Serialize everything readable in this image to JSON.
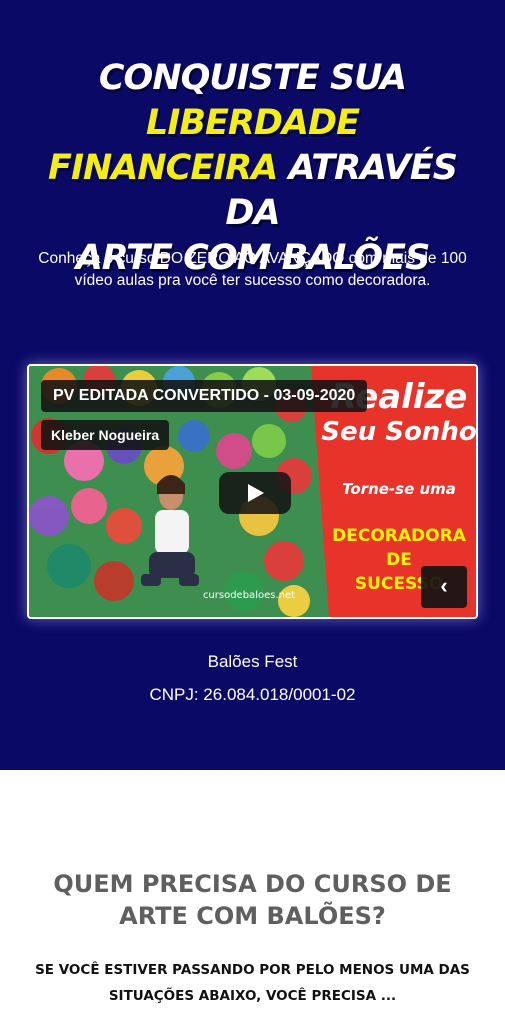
{
  "hero": {
    "headline": {
      "part1": "CONQUISTE SUA ",
      "highlight1": "LIBERDADE",
      "highlight2": "FINANCEIRA",
      "part2": " ATRAVÉS DA",
      "part3": "ARTE COM BALÕES"
    },
    "subtitle": "Conheça o curso DO ZERO AO AVANÇADO com mais de 100 vídeo aulas pra você ter sucesso como decoradora.",
    "video": {
      "title": "PV EDITADA CONVERTIDO - 03-09-2020",
      "author": "Kleber Nogueira",
      "prev_label": "‹",
      "thumb_text": {
        "line1": "Realize",
        "line2": "Seu Sonho",
        "line3": "Torne-se uma",
        "line4": "DECORADORA",
        "line5": "DE",
        "line6": "SUCESSO",
        "watermark": "cursodebaloes.net"
      }
    },
    "brand_name": "Balões Fest",
    "cnpj": "CNPJ: 26.084.018/0001-02"
  },
  "section": {
    "title": "QUEM PRECISA DO CURSO DE ARTE COM BALÕES?",
    "subtitle": "SE VOCÊ ESTIVER PASSANDO POR PELO MENOS UMA DAS SITUAÇÕES ABAIXO, VOCÊ PRECISA ..."
  },
  "colors": {
    "hero_bg": "#0b0966",
    "highlight": "#f5ee14",
    "thumb_red": "#e8332a",
    "thumb_yellow": "#fff200"
  },
  "icons": {
    "play": "play-icon",
    "prev": "chevron-left-icon"
  }
}
